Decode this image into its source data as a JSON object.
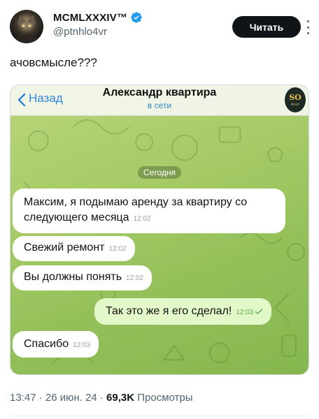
{
  "author": {
    "display_name": "MCMLXXXIV™",
    "handle": "@ptnhlo4vr",
    "verified_color": "#1d9bf0"
  },
  "actions": {
    "read_label": "Читать"
  },
  "tweet": {
    "text": "ачовсмысле???"
  },
  "telegram": {
    "back_label": "Назад",
    "chat_title": "Александр квартира",
    "chat_status": "в сети",
    "contact_logo": "SO",
    "contact_logo_sub": "Arom",
    "date_pill": "Сегодня",
    "messages": [
      {
        "text": "Максим, я подымаю аренду за квартиру со следующего месяца",
        "time": "12:02",
        "outgoing": false
      },
      {
        "text": "Свежий ремонт",
        "time": "12:02",
        "outgoing": false
      },
      {
        "text": "Вы должны понять",
        "time": "12:02",
        "outgoing": false
      },
      {
        "text": "Так это же я его сделал!",
        "time": "12:03",
        "outgoing": true
      },
      {
        "text": "Спасибо",
        "time": "12:03",
        "outgoing": false
      }
    ]
  },
  "meta": {
    "time": "13:47",
    "date": "26 июн. 24",
    "views_count": "69,3K",
    "views_label": "Просмотры",
    "separator": "·"
  }
}
